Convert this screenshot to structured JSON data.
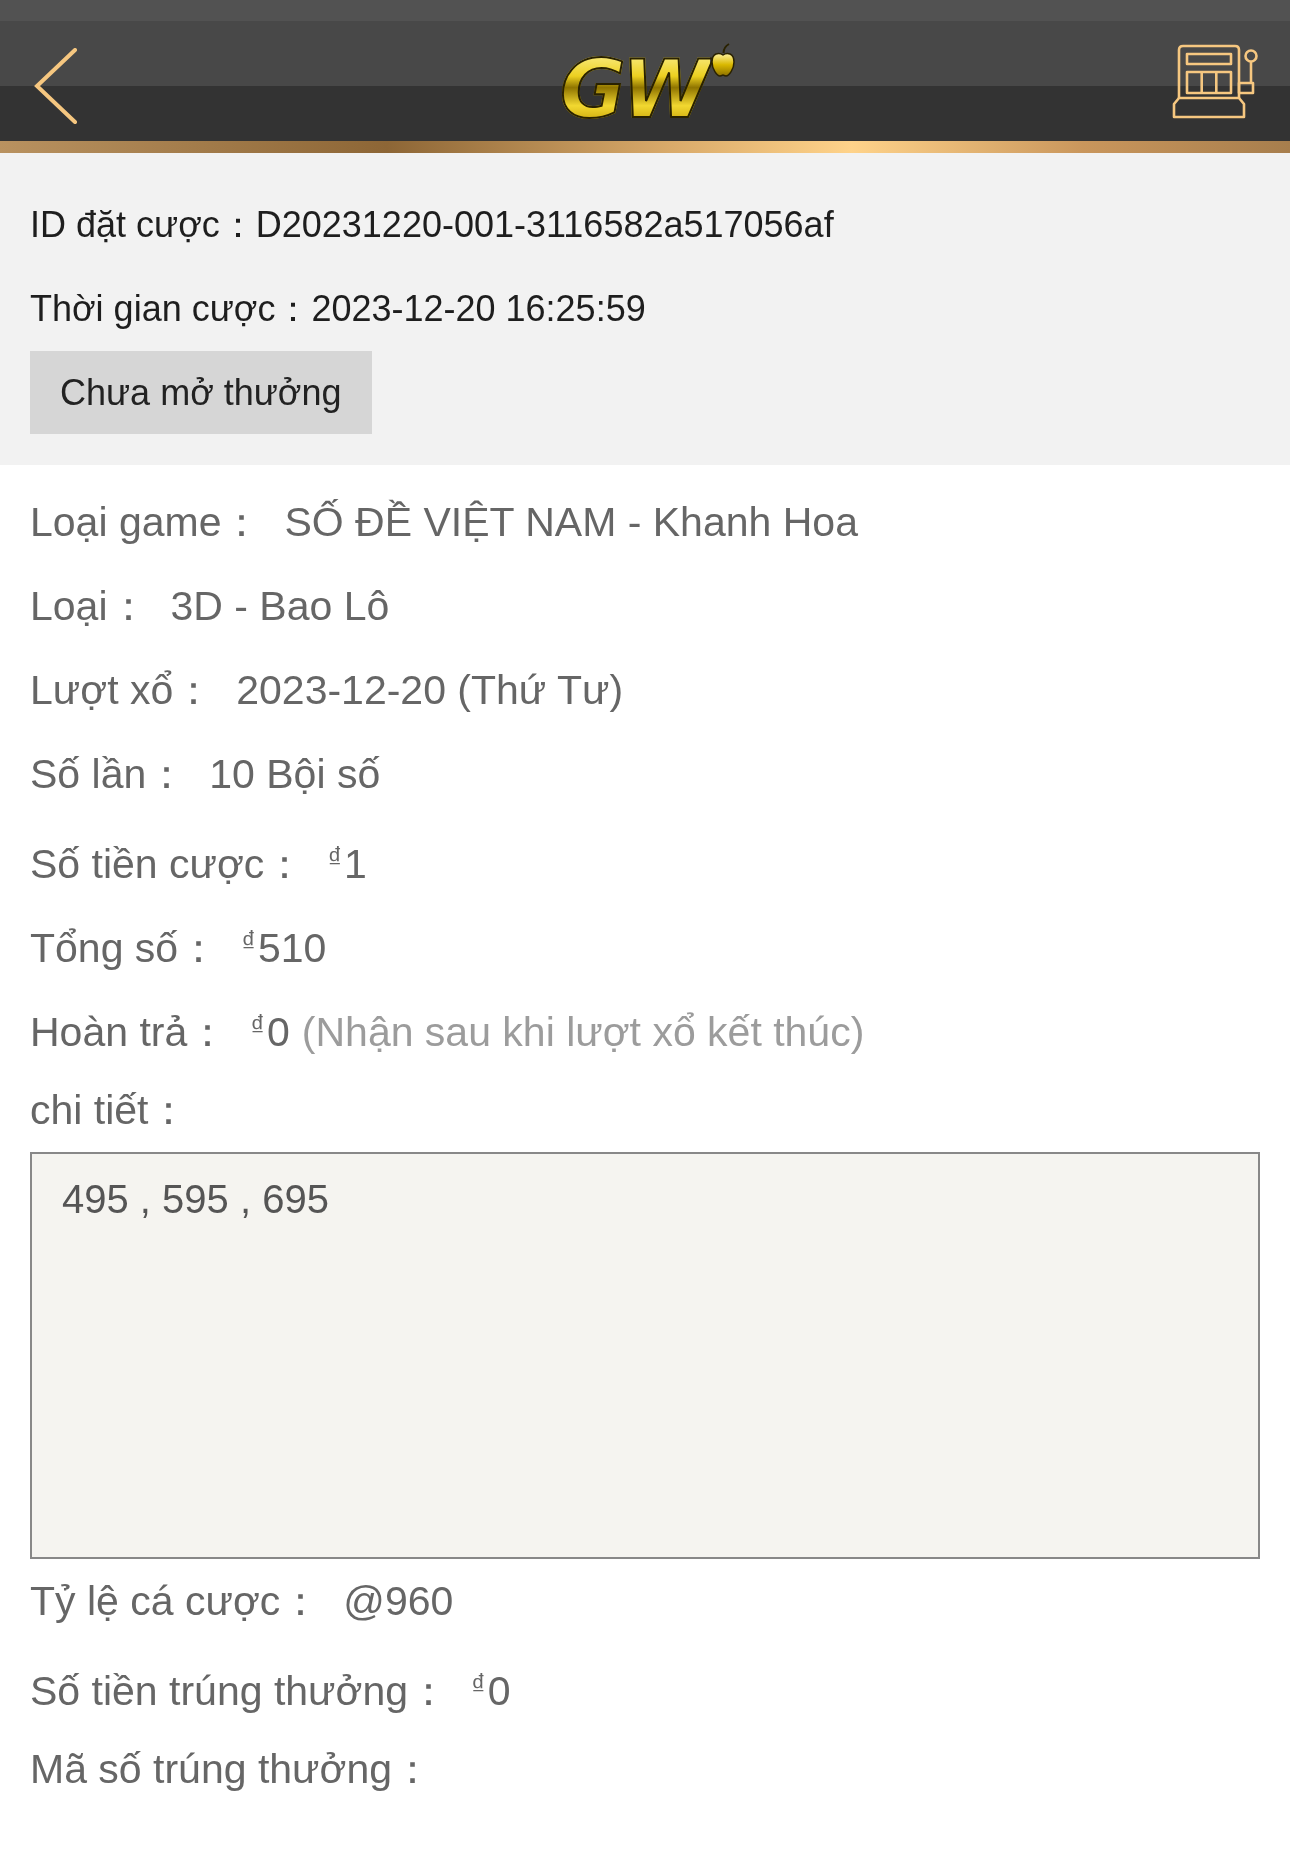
{
  "header": {
    "logo": "GW"
  },
  "bet_info": {
    "rows": [
      {
        "label": "ID đặt cược：",
        "value": "D20231220-001-3116582a517056af"
      },
      {
        "label": "Thời gian cược：",
        "value": "2023-12-20 16:25:59"
      }
    ],
    "status": "Chưa mở thưởng"
  },
  "details": [
    {
      "kind": "text",
      "label": "Loại game：",
      "value": "SỐ ĐỀ VIỆT NAM - Khanh Hoa"
    },
    {
      "kind": "text",
      "label": "Loại：",
      "value": "3D - Bao Lô"
    },
    {
      "kind": "text",
      "label": "Lượt xổ：",
      "value": "2023-12-20 (Thứ Tư)"
    },
    {
      "kind": "text",
      "label": "Số lần：",
      "value": "10 Bội số"
    },
    {
      "kind": "money",
      "label": "Số tiền cược：",
      "currency": "₫",
      "value": "1"
    },
    {
      "kind": "money",
      "label": "Tổng số：",
      "currency": "₫",
      "value": "510"
    },
    {
      "kind": "money",
      "label": "Hoàn trả：",
      "currency": "₫",
      "value": "0",
      "note": "(Nhận sau khi lượt xổ kết thúc)"
    },
    {
      "kind": "box",
      "label": "chi tiết：",
      "value": "495 , 595 , 695"
    },
    {
      "kind": "text",
      "label": "Tỷ lệ cá cược：",
      "value": "@960"
    },
    {
      "kind": "money",
      "label": "Số tiền trúng thưởng：",
      "currency": "₫",
      "value": "0"
    },
    {
      "kind": "text",
      "label": "Mã số trúng thưởng："
    }
  ]
}
